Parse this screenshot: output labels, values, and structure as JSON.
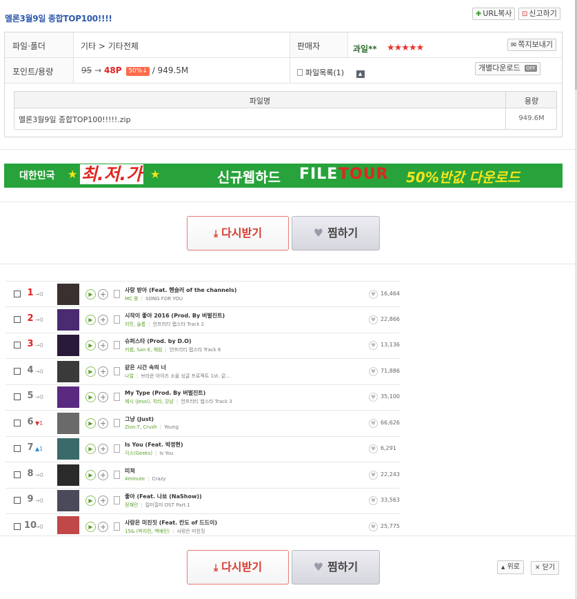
{
  "header": {
    "title": "멜론3월9일 종합TOP100!!!!",
    "url_copy": "URL복사",
    "report": "신고하기"
  },
  "info": {
    "file_folder_label": "파일·폴더",
    "category": "기타 > 기타전체",
    "seller_label": "판매자",
    "seller_name": "과일**",
    "seller_stars": "★★★★★",
    "message_button": "쪽지보내기",
    "point_size_label": "포인트/용량",
    "old_point": "95",
    "arrow": "→",
    "new_point": "48P",
    "discount_badge": "50%↓",
    "size": "/ 949.5M",
    "file_list": "파일목록(1)",
    "individual_download": "개별다운로드",
    "toggle_state": "OFF"
  },
  "files": {
    "header_name": "파일명",
    "header_size": "용량",
    "rows": [
      {
        "name": "멜론3월9일 종합TOP100!!!!!.zip",
        "size": "949.6M"
      }
    ]
  },
  "banner": {
    "part1": "대한민국",
    "part2": "최.저.가",
    "part3": "신규웹하드",
    "part4": "FILE",
    "part5": "TOUR",
    "part6": "50%반값 다운로드",
    "colors": {
      "bg": "#28a33b",
      "yellow": "#f5e51c",
      "red": "#e0261e"
    }
  },
  "actions": {
    "download": "다시받기",
    "wish": "찜하기",
    "top": "위로",
    "close": "닫기"
  },
  "chart": [
    {
      "rank": "1",
      "change": "→0",
      "dir": "same",
      "title": "사랑 받아 (Feat. 헨슬러 of the channels)",
      "artist": "MC 몽",
      "album": "SONG FOR YOU",
      "likes": "16,464",
      "color": "#3a3030"
    },
    {
      "rank": "2",
      "change": "→0",
      "dir": "same",
      "title": "시작이 좋아 2016 (Prod. By 버벌진트)",
      "artist": "지민, 슬롬",
      "album": "언프리티 랩스타 Track 2",
      "likes": "22,866",
      "color": "#4a2a70"
    },
    {
      "rank": "3",
      "change": "→0",
      "dir": "same",
      "title": "슈퍼스타 (Prod. by D.O)",
      "artist": "키썸, San E, 헤림",
      "album": "언프리티 랩스타 Track 6",
      "likes": "13,136",
      "color": "#2a1a3a"
    },
    {
      "rank": "4",
      "change": "→0",
      "dir": "same",
      "title": "같은 시간 속의 너",
      "artist": "나얼",
      "album": "브라운 아이즈 소울 싱글 프로젝트 1st. 같…",
      "likes": "71,886",
      "color": "#3a3a3a"
    },
    {
      "rank": "5",
      "change": "→0",
      "dir": "same",
      "title": "My Type (Prod. By 버벌진트)",
      "artist": "제시 (Jessi), 치타, 강남",
      "album": "언프리티 랩스타 Track 3",
      "likes": "35,100",
      "color": "#5a2a80"
    },
    {
      "rank": "6",
      "change": "▼1",
      "dir": "up",
      "title": "그냥 (Just)",
      "artist": "Zion.T, Crush",
      "album": "Young",
      "likes": "66,626",
      "color": "#6a6a6a"
    },
    {
      "rank": "7",
      "change": "▲1",
      "dir": "down",
      "title": "Is You (Feat. 박정현)",
      "artist": "긱스(Geeks)",
      "album": "Is You",
      "likes": "6,291",
      "color": "#3a6a6a"
    },
    {
      "rank": "8",
      "change": "→0",
      "dir": "same",
      "title": "미쳐",
      "artist": "4minute",
      "album": "Crazy",
      "likes": "22,243",
      "color": "#2a2a2a"
    },
    {
      "rank": "9",
      "change": "→0",
      "dir": "same",
      "title": "좋아 (Feat. 나쑈 (NaShow))",
      "artist": "정재민",
      "album": "킬미힐미 OST Part.1",
      "likes": "33,563",
      "color": "#4a4a5a"
    },
    {
      "rank": "10",
      "change": "→0",
      "dir": "same",
      "title": "사랑은 미친짓 (Feat. 칸도 of 드드이)",
      "artist": "15& (박지민, 백예린)",
      "album": "사랑은 미친짓",
      "likes": "25,775",
      "color": "#c04848"
    }
  ]
}
